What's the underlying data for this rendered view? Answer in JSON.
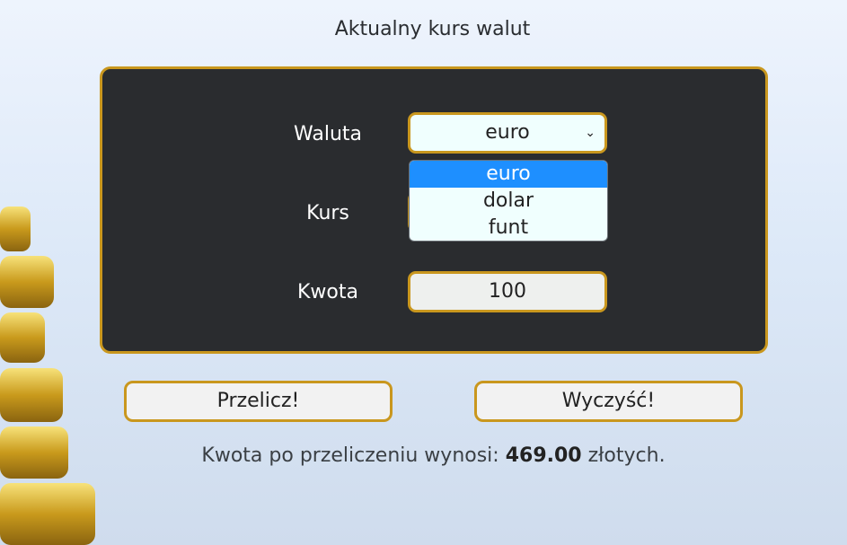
{
  "header": {
    "title": "Aktualny kurs walut"
  },
  "form": {
    "currency_label": "Waluta",
    "currency_value": "euro",
    "currency_options": [
      "euro",
      "dolar",
      "funt"
    ],
    "rate_label": "Kurs",
    "amount_label": "Kwota",
    "amount_value": "100"
  },
  "buttons": {
    "calculate": "Przelicz!",
    "clear": "Wyczyść!"
  },
  "result": {
    "prefix": "Kwota po przeliczeniu wynosi:",
    "value": "469.00",
    "suffix": "złotych."
  },
  "colors": {
    "accent": "#c9971e",
    "panel": "#2a2c2f",
    "highlight": "#1e8fff"
  },
  "icons": {
    "select_arrow": "chevron-down-icon",
    "background": "gold-coins-image"
  }
}
